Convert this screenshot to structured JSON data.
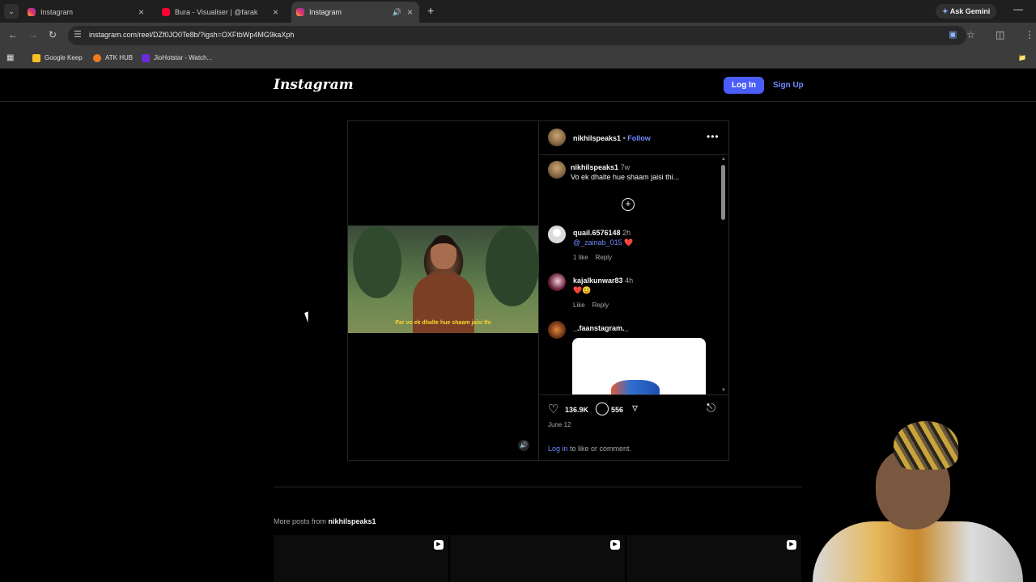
{
  "browser": {
    "tabs": [
      {
        "title": "Instagram",
        "icon": "instagram-icon"
      },
      {
        "title": "Bura - Visualiser | @farakmayb",
        "icon": "youtube-icon"
      },
      {
        "title": "Instagram",
        "icon": "instagram-icon",
        "active": true
      }
    ],
    "ask_gemini": "Ask Gemini",
    "url": "instagram.com/reel/DZf0JO0Te8b/?igsh=OXFtbWp4MG9kaXph",
    "bookmarks": [
      "Google Keep",
      "ATK HUB",
      "JioHotstar - Watch..."
    ],
    "colors": {
      "tabbar": "#1f1f1f",
      "toolbar": "#3c3c3c"
    }
  },
  "ig": {
    "logo": "Instagram",
    "login_label": "Log In",
    "signup_label": "Sign Up",
    "colors": {
      "accent": "#4a5df9",
      "link": "#6f8bff",
      "background": "#000000"
    }
  },
  "post": {
    "subtitle": "Par vo ek dhalte hue shaam jaisi thi",
    "author": "nikhilspeaks1",
    "follow_sep": "•",
    "follow_label": "Follow",
    "caption": {
      "user": "nikhilspeaks1",
      "time": "7w",
      "text": "Vo ek dhalte hue shaam jaisi thi..."
    },
    "comments": [
      {
        "user": "quail.6576148",
        "time": "2h",
        "mention": "@_zainab_015",
        "emoji": "❤️",
        "likes": "1 like",
        "reply": "Reply"
      },
      {
        "user": "kajalkunwar83",
        "time": "4h",
        "emoji": "❤️😊",
        "likes": "Like",
        "reply": "Reply"
      },
      {
        "user": "_.faanstagram._"
      }
    ],
    "likes": "136.9K",
    "comment_count": "556",
    "date": "June 12",
    "login_prompt_link": "Log in",
    "login_prompt_rest": " to like or comment."
  },
  "more_posts": {
    "label": "More posts from ",
    "user": "nikhilspeaks1"
  }
}
